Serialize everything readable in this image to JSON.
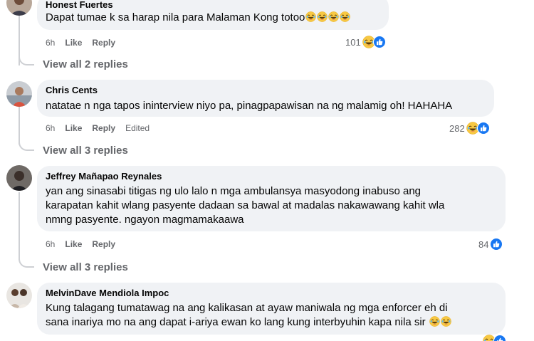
{
  "comments": [
    {
      "author": "Honest Fuertes",
      "text": "Dapat tumae k sa harap nila para Malaman Kong totoo",
      "time": "6h",
      "like_label": "Like",
      "reply_label": "Reply",
      "reaction_count": "101",
      "reactions": [
        "laugh-emoji",
        "like-emoji"
      ],
      "inline_emojis": [
        "laugh-emoji",
        "laugh-emoji",
        "laugh-emoji",
        "laugh-emoji"
      ],
      "view_replies": "View all 2 replies"
    },
    {
      "author": "Chris Cents",
      "text": "natatae n nga tapos ininterview niyo pa, pinagpapawisan na ng malamig oh! HAHAHA",
      "time": "6h",
      "like_label": "Like",
      "reply_label": "Reply",
      "edited_label": "Edited",
      "reaction_count": "282",
      "reactions": [
        "laugh-emoji",
        "like-emoji"
      ],
      "view_replies": "View all 3 replies"
    },
    {
      "author": "Jeffrey Mañapao Reynales",
      "text_lines": [
        "yan ang sinasabi titigas ng ulo lalo n mga ambulansya masyodong inabuso ang",
        "karapatan kahit wlang pasyente dadaan sa bawal at madalas nakawawang kahit wla",
        "nmng pasyente. ngayon magmamakaawa"
      ],
      "time": "6h",
      "like_label": "Like",
      "reply_label": "Reply",
      "reaction_count": "84",
      "reactions": [
        "like-emoji"
      ],
      "view_replies": "View all 3 replies"
    },
    {
      "author": "MelvinDave Mendiola Impoc",
      "text_lines": [
        "Kung talagang tumatawag na ang kalikasan at ayaw maniwala ng mga enforcer eh di",
        "sana inariya mo na ang dapat i-ariya ewan ko lang kung interbyuhin kapa nila sir"
      ],
      "inline_emojis": [
        "laugh-emoji",
        "laugh-emoji"
      ]
    }
  ],
  "colors": {
    "bubble": "#f0f2f5",
    "meta_text": "#65676b",
    "thread_line": "#ced0d4",
    "like_blue": "#1877f2",
    "laugh_yellow": "#f7c843"
  }
}
